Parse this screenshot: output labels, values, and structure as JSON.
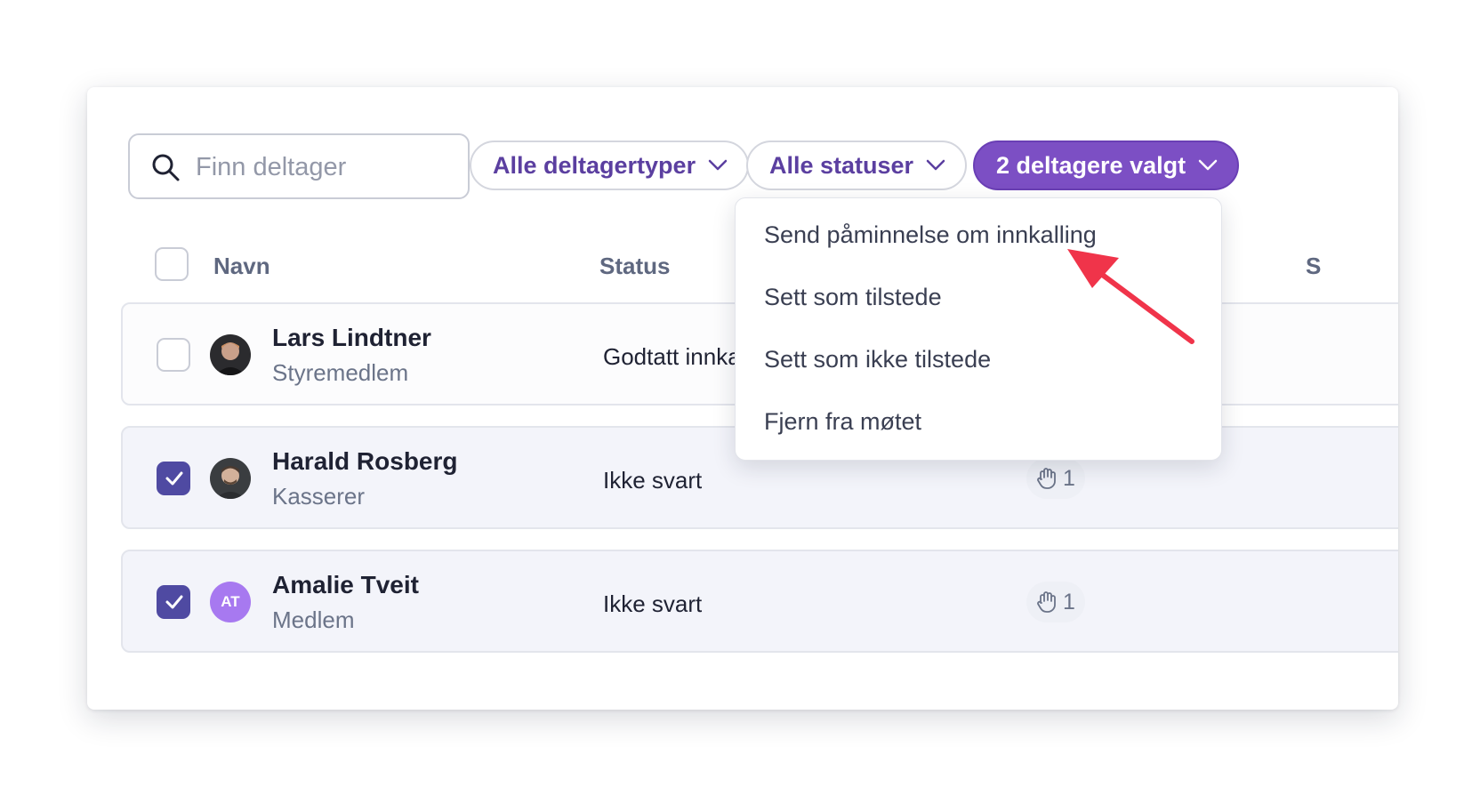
{
  "search": {
    "placeholder": "Finn deltager"
  },
  "filters": {
    "types_label": "Alle deltagertyper",
    "status_label": "Alle statuser",
    "selection_label": "2 deltagere valgt"
  },
  "table": {
    "headers": {
      "name": "Navn",
      "status": "Status",
      "extra": "S"
    },
    "rows": [
      {
        "name": "Lars Lindtner",
        "role": "Styremedlem",
        "status": "Godtatt innka",
        "checked": false
      },
      {
        "name": "Harald Rosberg",
        "role": "Kasserer",
        "status": "Ikke svart",
        "checked": true,
        "hand_count": "1"
      },
      {
        "name": "Amalie Tveit",
        "role": "Medlem",
        "status": "Ikke svart",
        "checked": true,
        "hand_count": "1",
        "initials": "AT"
      }
    ]
  },
  "menu": {
    "items": [
      "Send påminnelse om innkalling",
      "Sett som tilstede",
      "Sett som ikke tilstede",
      "Fjern fra møtet"
    ]
  },
  "colors": {
    "accent": "#7c4fc4",
    "checkbox_checked": "#4f4aa2",
    "annotation_arrow": "#f0344a",
    "avatar_initials_bg": "#a779f0"
  },
  "icons": [
    "search-icon",
    "chevron-down-icon",
    "check-icon",
    "hand-icon",
    "annotation-arrow"
  ]
}
